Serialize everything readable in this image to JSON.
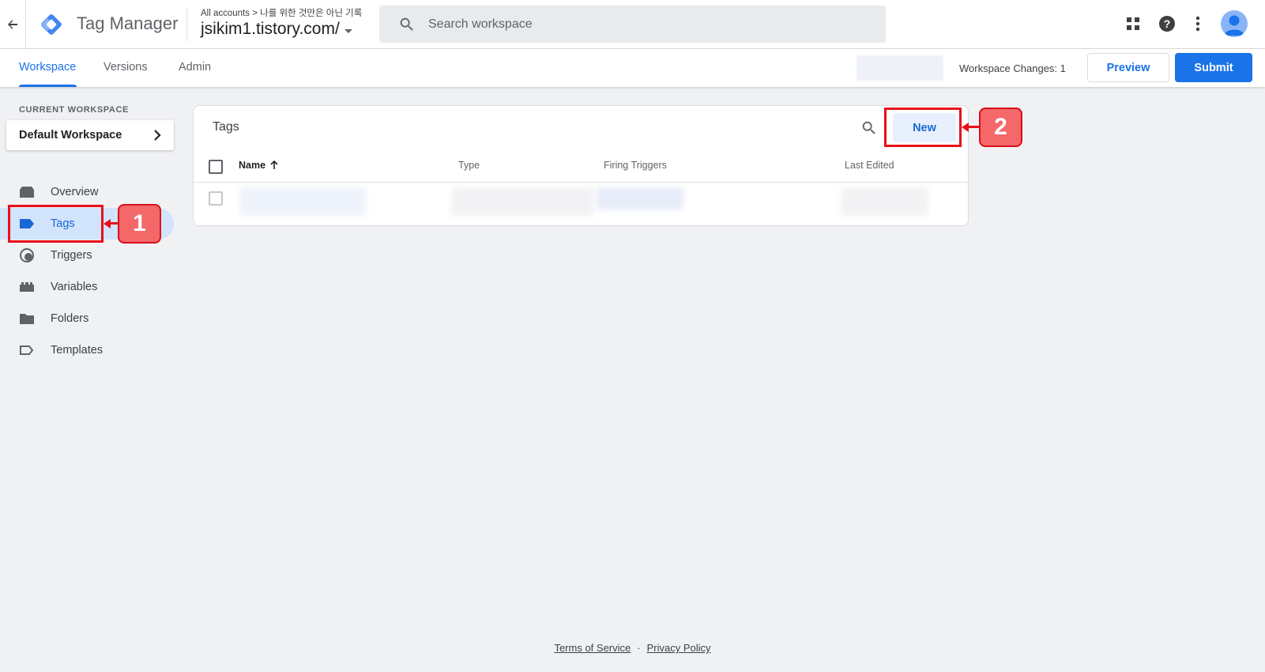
{
  "topbar": {
    "back_icon": "arrow-left-icon",
    "app_title": "Tag Manager",
    "breadcrumb": "All accounts > 나를 위한 것만은 아닌 기록",
    "container": "jsikim1.tistory.com/",
    "search_placeholder": "Search workspace"
  },
  "subnav": {
    "tabs": [
      "Workspace",
      "Versions",
      "Admin"
    ],
    "workspace_changes": "Workspace Changes: 1",
    "preview_label": "Preview",
    "submit_label": "Submit"
  },
  "sidebar": {
    "current_workspace_label": "CURRENT WORKSPACE",
    "workspace_name": "Default Workspace",
    "items": [
      {
        "label": "Overview",
        "icon": "overview-icon"
      },
      {
        "label": "Tags",
        "icon": "tag-icon",
        "active": true
      },
      {
        "label": "Triggers",
        "icon": "trigger-icon"
      },
      {
        "label": "Variables",
        "icon": "variables-icon"
      },
      {
        "label": "Folders",
        "icon": "folder-icon"
      },
      {
        "label": "Templates",
        "icon": "template-icon"
      }
    ]
  },
  "tags_panel": {
    "title": "Tags",
    "new_label": "New",
    "columns": [
      "Name",
      "Type",
      "Firing Triggers",
      "Last Edited"
    ]
  },
  "annotations": {
    "badge_1": "1",
    "badge_2": "2"
  },
  "footer": {
    "terms": "Terms of Service",
    "separator": "·",
    "privacy": "Privacy Policy"
  },
  "colors": {
    "accent": "#1a73e8",
    "highlight": "#e8101a",
    "badge_fill": "#f4686a"
  }
}
